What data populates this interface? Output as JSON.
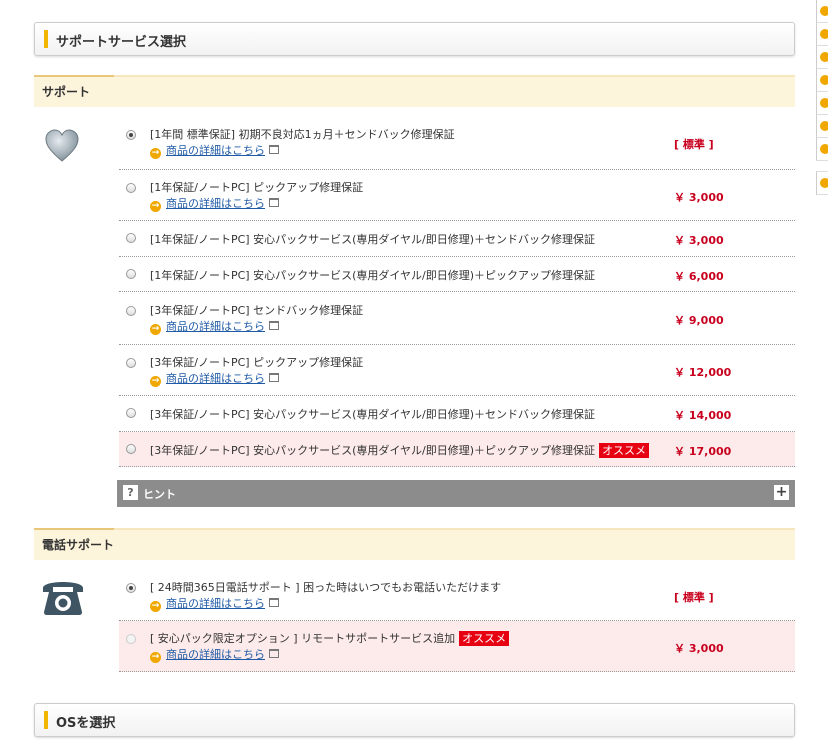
{
  "sections": {
    "support_service_title": "サポートサービス選択",
    "os_title": "OSを選択"
  },
  "categories": {
    "support": "サポート",
    "phone_support": "電話サポート"
  },
  "common": {
    "detail_link": "商品の詳細はこちら",
    "recommend_badge": "オススメ"
  },
  "support_options": [
    {
      "label": "[1年間 標準保証] 初期不良対応1ヵ月＋センドバック修理保証",
      "price": "[ 標準 ]",
      "checked": true,
      "detail": true,
      "recommended": false
    },
    {
      "label": "[1年保証/ノートPC] ピックアップ修理保証",
      "price": "￥ 3,000",
      "checked": false,
      "detail": true,
      "recommended": false
    },
    {
      "label": "[1年保証/ノートPC] 安心パックサービス(専用ダイヤル/即日修理)＋センドバック修理保証",
      "price": "￥ 3,000",
      "checked": false,
      "detail": false,
      "recommended": false
    },
    {
      "label": "[1年保証/ノートPC] 安心パックサービス(専用ダイヤル/即日修理)＋ピックアップ修理保証",
      "price": "￥ 6,000",
      "checked": false,
      "detail": false,
      "recommended": false
    },
    {
      "label": "[3年保証/ノートPC] センドバック修理保証",
      "price": "￥ 9,000",
      "checked": false,
      "detail": true,
      "recommended": false
    },
    {
      "label": "[3年保証/ノートPC] ピックアップ修理保証",
      "price": "￥ 12,000",
      "checked": false,
      "detail": true,
      "recommended": false
    },
    {
      "label": "[3年保証/ノートPC] 安心パックサービス(専用ダイヤル/即日修理)＋センドバック修理保証",
      "price": "￥ 14,000",
      "checked": false,
      "detail": false,
      "recommended": false
    },
    {
      "label": "[3年保証/ノートPC] 安心パックサービス(専用ダイヤル/即日修理)＋ピックアップ修理保証",
      "price": "￥ 17,000",
      "checked": false,
      "detail": false,
      "recommended": true
    }
  ],
  "hint": {
    "label": "ヒント",
    "expand_symbol": "+",
    "q_symbol": "?"
  },
  "phone_options": [
    {
      "label": "[ 24時間365日電話サポート ] 困った時はいつでもお電話いただけます",
      "price": "[ 標準 ]",
      "checked": true,
      "detail": true,
      "recommended": false
    },
    {
      "label": "[ 安心パック限定オプション ] リモートサポートサービス追加",
      "price": "￥ 3,000",
      "checked": false,
      "detail": true,
      "recommended": true,
      "disabled": true
    }
  ],
  "colors": {
    "accent": "#f2b600",
    "price": "#c8001e",
    "badge": "#e60012",
    "link": "#1f5aa6"
  },
  "icons": {
    "support": "heart-icon",
    "phone_support": "telephone-icon"
  }
}
